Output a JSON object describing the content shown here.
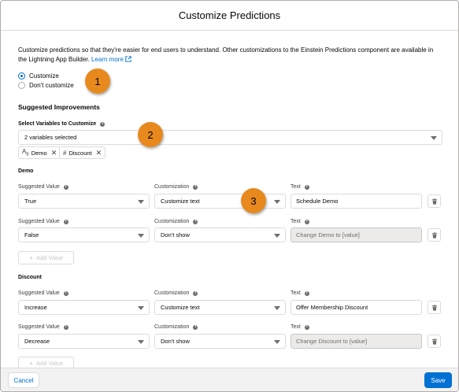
{
  "modal": {
    "title": "Customize Predictions",
    "intro_text": "Customize predictions so that they're easier for end users to understand. Other customizations to the Einstein Predictions component are available in the Lightning App Builder.",
    "learn_more": "Learn more",
    "radio_customize": "Customize",
    "radio_dont_customize": "Don't customize",
    "selected_option": "Customize"
  },
  "improvements": {
    "title": "Suggested Improvements",
    "select_label": "Select Variables to Customize",
    "select_value": "2 variables selected",
    "pills": [
      {
        "icon": "text-type-icon",
        "label": "Demo"
      },
      {
        "icon": "number-type-icon",
        "label": "Discount"
      }
    ]
  },
  "labels": {
    "suggested_value": "Suggested Value",
    "customization": "Customization",
    "text": "Text",
    "add_value": "Add Value"
  },
  "sections": [
    {
      "name": "Demo",
      "rows": [
        {
          "suggested": "True",
          "customization": "Customize text",
          "text": "Schedule Demo",
          "text_disabled": false
        },
        {
          "suggested": "False",
          "customization": "Don't show",
          "text": "Change Demo to [value]",
          "text_disabled": true
        }
      ]
    },
    {
      "name": "Discount",
      "rows": [
        {
          "suggested": "Increase",
          "customization": "Customize text",
          "text": "Offer Membership Discount",
          "text_disabled": false
        },
        {
          "suggested": "Decrease",
          "customization": "Don't show",
          "text": "Change Discount to [value]",
          "text_disabled": true
        }
      ]
    }
  ],
  "callouts": [
    "1",
    "2",
    "3"
  ],
  "footer": {
    "cancel_label": "Cancel",
    "save_label": "Save"
  },
  "colors": {
    "brand": "#0070d2",
    "callout": "#e8891e",
    "disabled_bg": "#ecebea"
  }
}
